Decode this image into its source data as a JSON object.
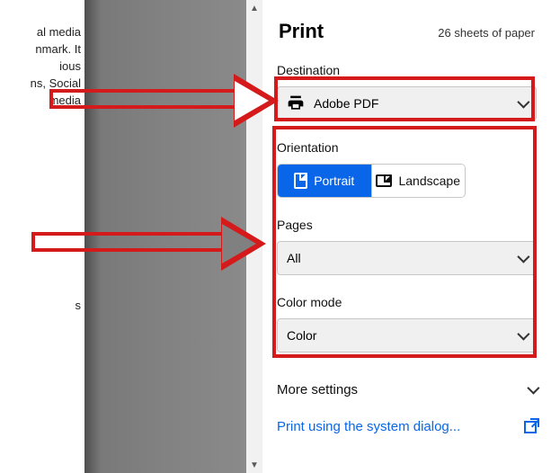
{
  "document_snippet": {
    "block1": [
      "al media",
      "nmark. It",
      "ious",
      "ns, Social",
      "media"
    ],
    "block2": [
      "s"
    ]
  },
  "print": {
    "title": "Print",
    "sheets": "26 sheets of paper",
    "destination": {
      "label": "Destination",
      "value": "Adobe PDF"
    },
    "orientation": {
      "label": "Orientation",
      "portrait": "Portrait",
      "landscape": "Landscape"
    },
    "pages": {
      "label": "Pages",
      "value": "All"
    },
    "colormode": {
      "label": "Color mode",
      "value": "Color"
    },
    "more": "More settings",
    "link": "Print using the system dialog..."
  }
}
